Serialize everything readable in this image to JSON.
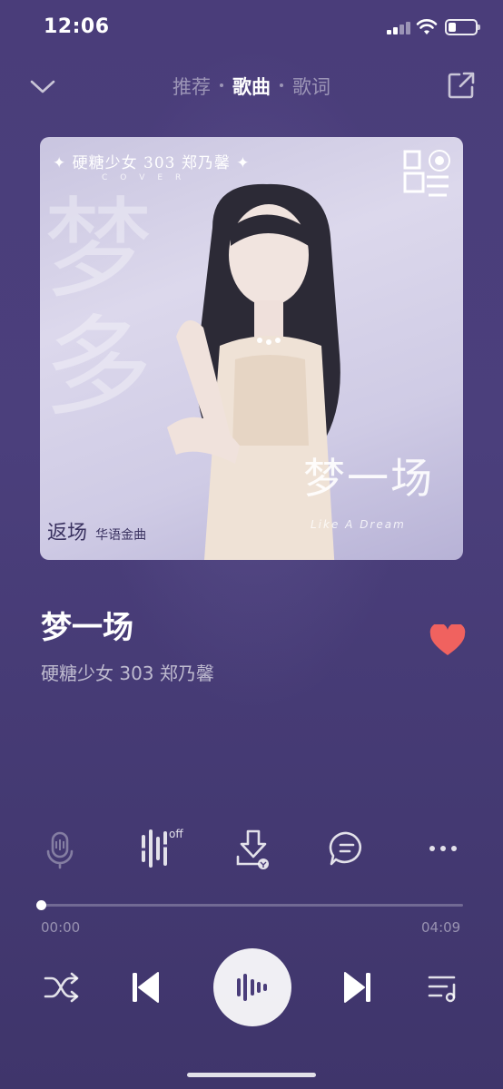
{
  "status_bar": {
    "time": "12:06",
    "battery_level": 0.3
  },
  "header": {
    "tabs": [
      {
        "label": "推荐",
        "active": false
      },
      {
        "label": "歌曲",
        "active": true
      },
      {
        "label": "歌词",
        "active": false
      }
    ]
  },
  "cover": {
    "title": "✦ 硬糖少女 303  郑乃馨 ✦",
    "subtitle": "COVER",
    "logo_text": "硬糖少女",
    "big_char": "梦\n多",
    "song_text": "梦一场",
    "english_text": "Like A Dream",
    "badge_text": "返场",
    "badge_sub": "华语金曲"
  },
  "song": {
    "title": "梦一场",
    "artist": "硬糖少女 303 郑乃馨",
    "liked": true
  },
  "actions": {
    "off_label": "off",
    "icons": [
      "microphone-icon",
      "sound-effect-icon",
      "download-icon",
      "comment-icon",
      "more-icon"
    ]
  },
  "progress": {
    "current": "00:00",
    "total": "04:09",
    "fraction": 0.0
  },
  "colors": {
    "background": "#4a3d7a",
    "heart": "#f0625f",
    "play_button": "#ffffff"
  }
}
